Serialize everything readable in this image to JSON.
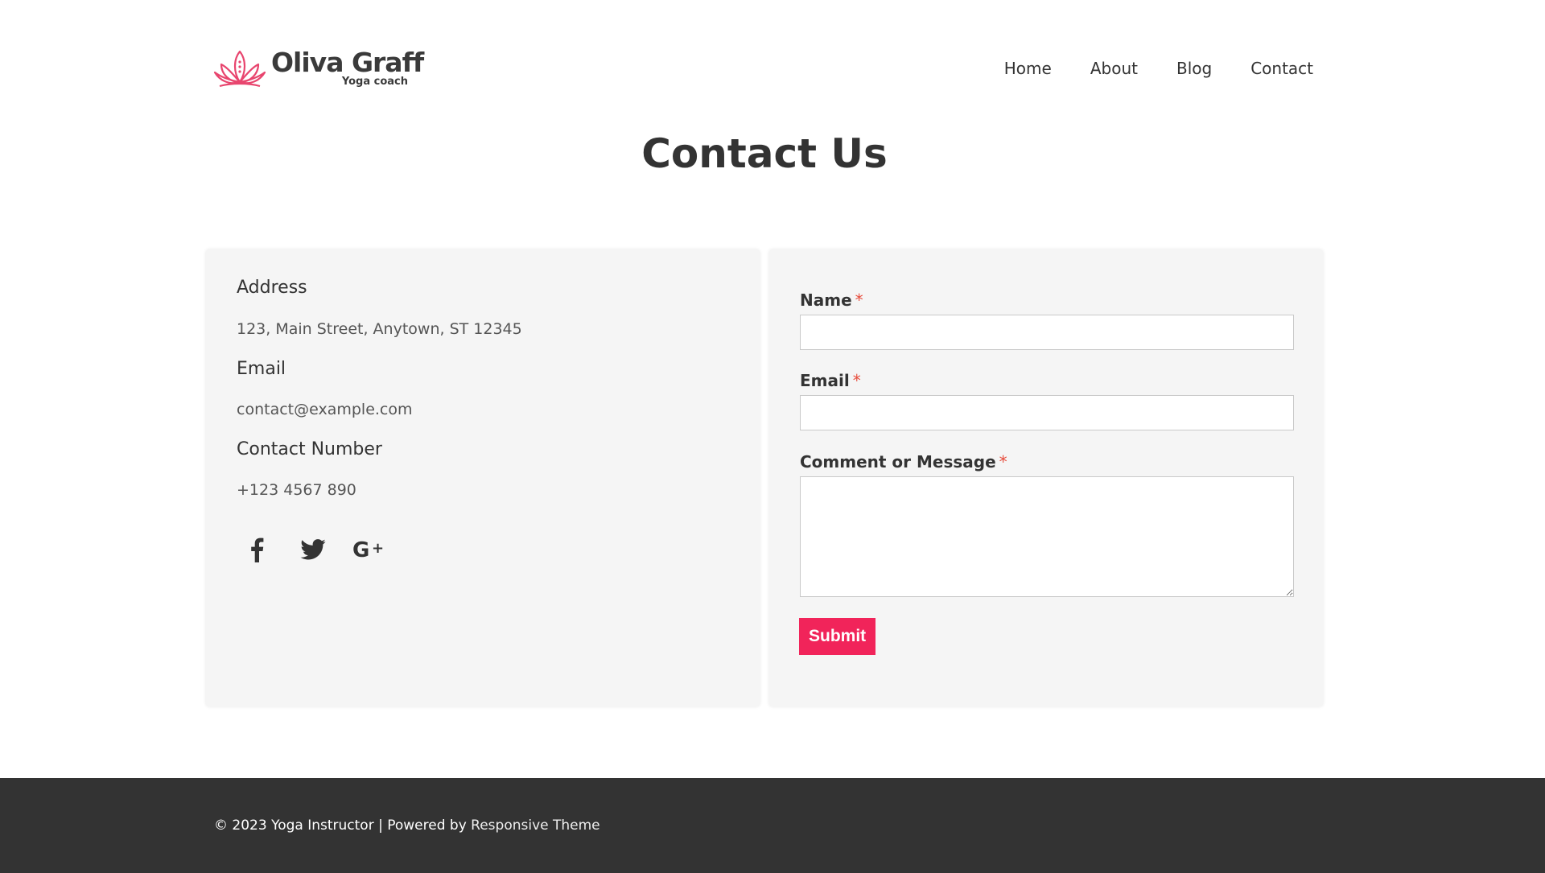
{
  "brand": {
    "name": "Oliva Graff",
    "tagline": "Yoga coach",
    "accent_color": "#e8456e"
  },
  "nav": {
    "items": [
      "Home",
      "About",
      "Blog",
      "Contact"
    ]
  },
  "page_title": "Contact Us",
  "info": {
    "address_heading": "Address",
    "address_value": "123, Main Street, Anytown, ST 12345",
    "email_heading": "Email",
    "email_value": "contact@example.com",
    "phone_heading": "Contact Number",
    "phone_value": "+123 4567 890",
    "social_icons": [
      "facebook-icon",
      "twitter-icon",
      "google-plus-icon"
    ]
  },
  "form": {
    "name_label": "Name",
    "email_label": "Email",
    "message_label": "Comment or Message",
    "required_marker": "*",
    "name_value": "",
    "email_value": "",
    "message_value": "",
    "submit_label": "Submit",
    "submit_color": "#f1245a"
  },
  "footer": {
    "copyright": "© 2023 Yoga Instructor | Powered by ",
    "link_text": "Responsive Theme",
    "background": "#333333"
  }
}
